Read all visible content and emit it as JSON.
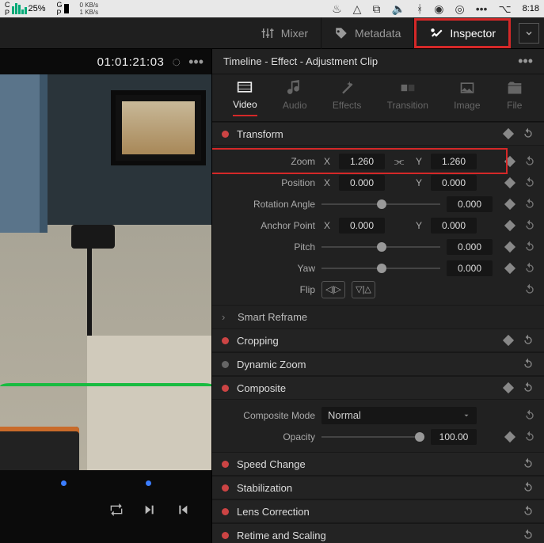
{
  "menubar": {
    "cpu_pct": "25%",
    "net_up": "0 KB/s",
    "net_down": "1 KB/s",
    "clock": "8:18"
  },
  "topbar": {
    "mixer": "Mixer",
    "metadata": "Metadata",
    "inspector": "Inspector"
  },
  "viewer": {
    "timecode": "01:01:21:03"
  },
  "inspector_title": "Timeline - Effect - Adjustment Clip",
  "tabs": {
    "video": "Video",
    "audio": "Audio",
    "effects": "Effects",
    "transition": "Transition",
    "image": "Image",
    "file": "File"
  },
  "transform": {
    "title": "Transform",
    "zoom_label": "Zoom",
    "zoom_x": "1.260",
    "zoom_y": "1.260",
    "position_label": "Position",
    "position_x": "0.000",
    "position_y": "0.000",
    "rotation_label": "Rotation Angle",
    "rotation": "0.000",
    "anchor_label": "Anchor Point",
    "anchor_x": "0.000",
    "anchor_y": "0.000",
    "pitch_label": "Pitch",
    "pitch": "0.000",
    "yaw_label": "Yaw",
    "yaw": "0.000",
    "flip_label": "Flip"
  },
  "sections": {
    "smart_reframe": "Smart Reframe",
    "cropping": "Cropping",
    "dynamic_zoom": "Dynamic Zoom",
    "composite": "Composite",
    "composite_mode_label": "Composite Mode",
    "composite_mode_value": "Normal",
    "opacity_label": "Opacity",
    "opacity_value": "100.00",
    "speed_change": "Speed Change",
    "stabilization": "Stabilization",
    "lens_correction": "Lens Correction",
    "retime": "Retime and Scaling"
  },
  "axis": {
    "x": "X",
    "y": "Y"
  }
}
